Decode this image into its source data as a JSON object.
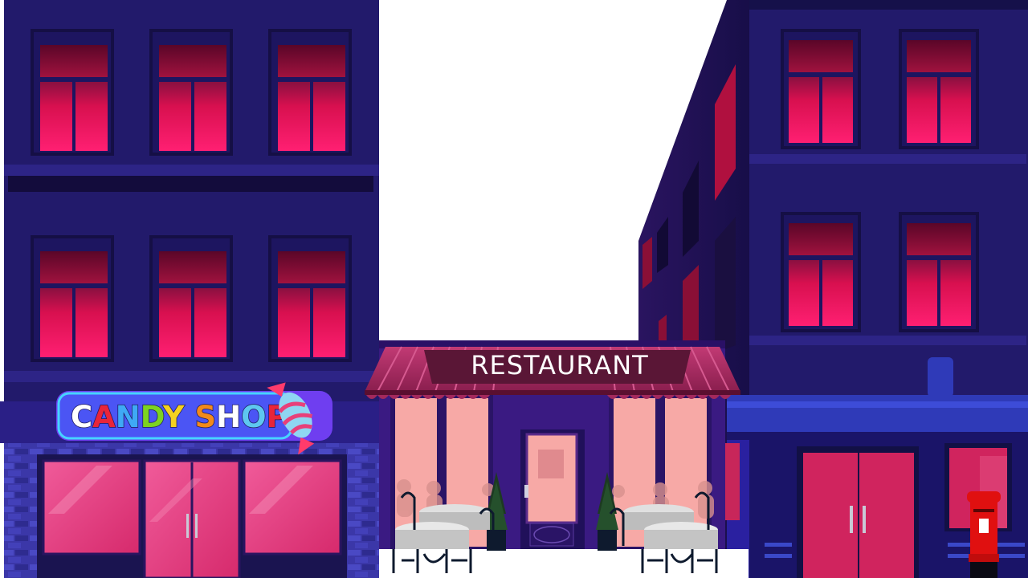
{
  "candy_shop": {
    "sign_letters": [
      {
        "ch": "C",
        "color": "#ffffff"
      },
      {
        "ch": "A",
        "color": "#e8253a"
      },
      {
        "ch": "N",
        "color": "#3fa9f5"
      },
      {
        "ch": "D",
        "color": "#7dd321"
      },
      {
        "ch": "Y",
        "color": "#f4d21f"
      },
      {
        "ch": " ",
        "color": "#ffffff"
      },
      {
        "ch": "S",
        "color": "#f28a1a"
      },
      {
        "ch": "H",
        "color": "#ffffff"
      },
      {
        "ch": "O",
        "color": "#5ec7f0"
      },
      {
        "ch": "P",
        "color": "#e8253a"
      }
    ],
    "sign_icon": "wrapped-candy-icon"
  },
  "restaurant": {
    "sign_text": "RESTAURANT"
  },
  "colors": {
    "building": "#22196a",
    "building_dark": "#160f4a",
    "window_glow": "#ff1a6e",
    "awning": "#a3295c",
    "postbox": "#e01010"
  }
}
